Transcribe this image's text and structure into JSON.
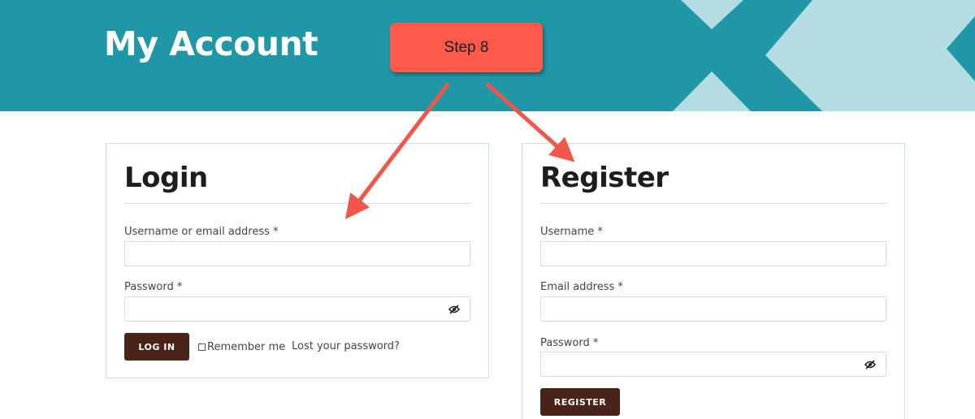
{
  "header": {
    "title": "My Account",
    "background_color": "#2097a6"
  },
  "annotation": {
    "step_label": "Step 8",
    "color": "#fd5a4b"
  },
  "login": {
    "title": "Login",
    "username_label": "Username or email address *",
    "username_value": "",
    "password_label": "Password *",
    "password_value": "",
    "login_button": "LOG IN",
    "remember_label": "Remember me",
    "remember_checked": false,
    "lost_password_link": "Lost your password?"
  },
  "register": {
    "title": "Register",
    "username_label": "Username *",
    "username_value": "",
    "email_label": "Email address *",
    "email_value": "",
    "password_label": "Password *",
    "password_value": "",
    "register_button": "REGISTER"
  },
  "icons": {
    "password_toggle": "eye-slash-icon"
  },
  "colors": {
    "button_bg": "#4a2418",
    "border": "#c9e3e3"
  }
}
